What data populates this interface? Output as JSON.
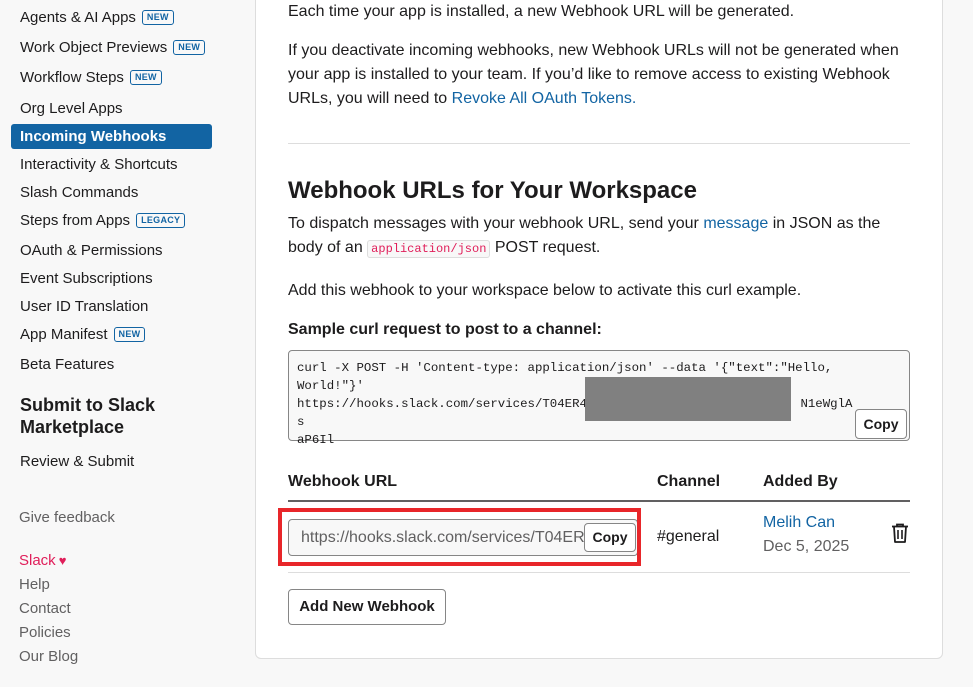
{
  "sidebar": {
    "items": [
      {
        "label": "Agents & AI Apps",
        "badge": "NEW"
      },
      {
        "label": "Work Object Previews",
        "badge": "NEW"
      },
      {
        "label": "Workflow Steps",
        "badge": "NEW"
      },
      {
        "label": "Org Level Apps",
        "badge": ""
      },
      {
        "label": "Incoming Webhooks",
        "badge": "",
        "active": true
      },
      {
        "label": "Interactivity & Shortcuts",
        "badge": ""
      },
      {
        "label": "Slash Commands",
        "badge": ""
      },
      {
        "label": "Steps from Apps",
        "badge": "LEGACY"
      },
      {
        "label": "OAuth & Permissions",
        "badge": ""
      },
      {
        "label": "Event Subscriptions",
        "badge": ""
      },
      {
        "label": "User ID Translation",
        "badge": ""
      },
      {
        "label": "App Manifest",
        "badge": "NEW"
      },
      {
        "label": "Beta Features",
        "badge": ""
      }
    ],
    "submit_title": "Submit to Slack Marketplace",
    "review_submit": "Review & Submit",
    "give_feedback": "Give feedback",
    "footer": {
      "slack": "Slack",
      "help": "Help",
      "contact": "Contact",
      "policies": "Policies",
      "blog": "Our Blog"
    }
  },
  "main": {
    "intro1": "Each time your app is installed, a new Webhook URL will be generated.",
    "intro2_pre": "If you deactivate incoming webhooks, new Webhook URLs will not be generated when your app is installed to your team. If you’d like to remove access to existing Webhook URLs, you will need to ",
    "intro2_link": "Revoke All OAuth Tokens.",
    "section_title": "Webhook URLs for Your Workspace",
    "dispatch_pre": "To dispatch messages with your webhook URL, send your ",
    "dispatch_link": "message",
    "dispatch_mid": " in JSON as the body of an ",
    "dispatch_code": "application/json",
    "dispatch_post": " POST request.",
    "add_hint": "Add this webhook to your workspace below to activate this curl example.",
    "sample_label": "Sample curl request to post to a channel:",
    "curl_line1": "curl -X POST -H 'Content-type: application/json' --data '{\"text\":\"Hello,",
    "curl_line2": "World!\"}'",
    "curl_line3_pre": "https://hooks.slack.com/services/T04ER4G",
    "curl_line3_post": "N1eWglAs",
    "curl_line4": "aP6Il",
    "copy_label": "Copy",
    "table": {
      "headers": {
        "url": "Webhook URL",
        "channel": "Channel",
        "added_by": "Added By"
      },
      "row": {
        "url": "https://hooks.slack.com/services/T04ER4G",
        "copy": "Copy",
        "channel": "#general",
        "user": "Melih Can",
        "date": "Dec 5, 2025"
      }
    },
    "add_webhook": "Add New Webhook"
  }
}
